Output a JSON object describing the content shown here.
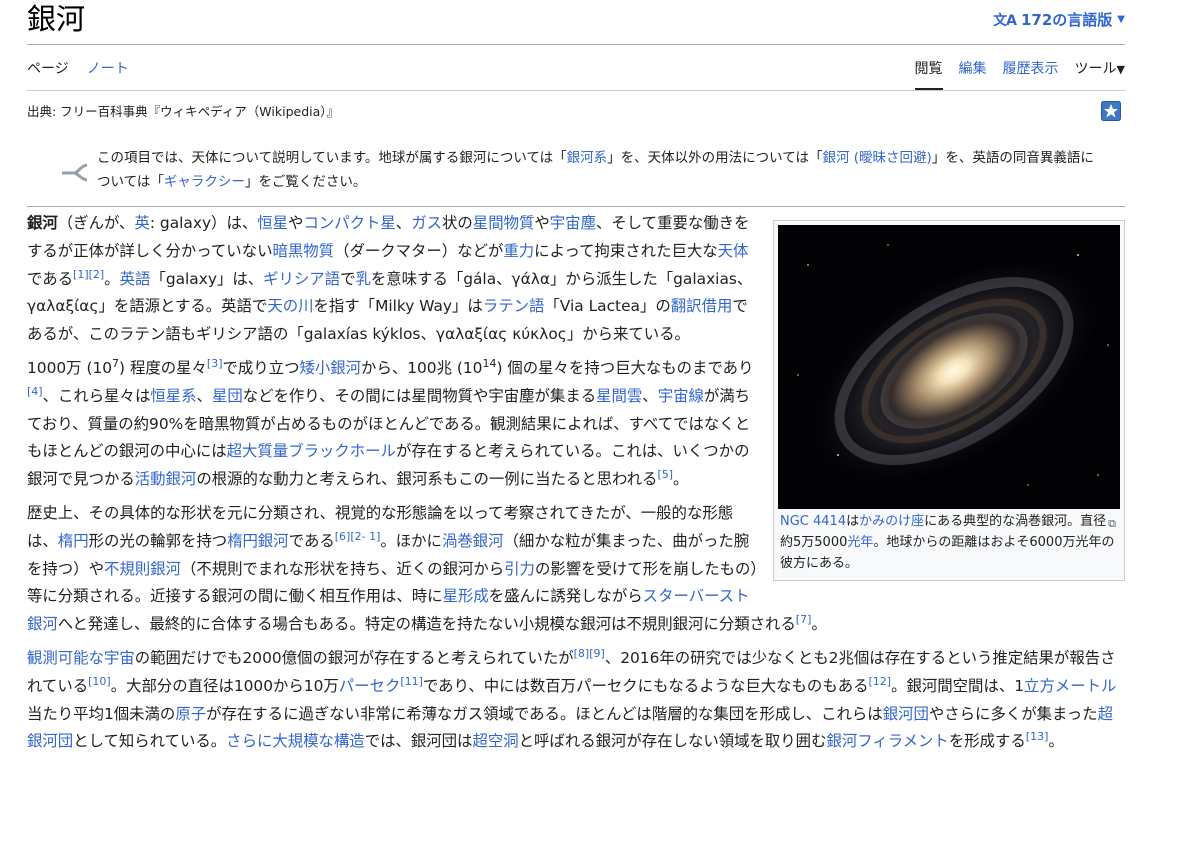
{
  "header": {
    "title": "銀河",
    "languages_label": "172の言語版"
  },
  "tabs": {
    "page": "ページ",
    "talk": "ノート",
    "read": "閲覧",
    "edit": "編集",
    "history": "履歴表示",
    "tools": "ツール"
  },
  "source": "出典: フリー百科事典『ウィキペディア（Wikipedia）』",
  "hatnote": {
    "t1": "この項目では、天体について説明しています。地球が属する銀河については「",
    "l1": "銀河系",
    "t2": "」を、天体以外の用法については「",
    "l2": "銀河 (曖昧さ回避)",
    "t3": "」を、英語の同音異義語については「",
    "l3": "ギャラクシー",
    "t4": "」をご覧ください。"
  },
  "image": {
    "caption": {
      "l1": "NGC 4414",
      "t1": "は",
      "l2": "かみのけ座",
      "t2": "にある典型的な渦巻銀河。直径約5万5000",
      "l3": "光年",
      "t3": "。地球からの距離はおよそ6000万光年の彼方にある。"
    }
  },
  "p1": {
    "b": "銀河",
    "t1": "（ぎんが、",
    "l1": "英",
    "t2": ": galaxy）は、",
    "l2": "恒星",
    "t3": "や",
    "l3": "コンパクト星",
    "t4": "、",
    "l4": "ガス",
    "t5": "状の",
    "l5": "星間物質",
    "t6": "や",
    "l6": "宇宙塵",
    "t7": "、そして重要な働きをするが正体が詳しく分かっていない",
    "l7": "暗黒物質",
    "t8": "（ダークマター）などが",
    "l8": "重力",
    "t9": "によって拘束された巨大な",
    "l9": "天体",
    "t10": "である",
    "s1": "[1]",
    "s2": "[2]",
    "t11": "。",
    "l10": "英語",
    "t12": "「galaxy」は、",
    "l11": "ギリシア語",
    "t13": "で",
    "l12": "乳",
    "t14": "を意味する「gála、γάλα」から派生した「galaxias、γαλαξίας」を語源とする。英語で",
    "l13": "天の川",
    "t15": "を指す「Milky Way」は",
    "l14": "ラテン語",
    "t16": "「Via Lactea」の",
    "l15": "翻訳借用",
    "t17": "であるが、このラテン語もギリシア語の「galaxías kýklos、γαλαξίας κύκλος」から来ている。"
  },
  "p2": {
    "t1": "1000万 (10",
    "e1": "7",
    "t2": ") 程度の星々",
    "s1": "[3]",
    "t3": "で成り立つ",
    "l1": "矮小銀河",
    "t4": "から、100兆 (10",
    "e2": "14",
    "t5": ") 個の星々を持つ巨大なものまであり",
    "s2": "[4]",
    "t6": "、これら星々は",
    "l2": "恒星系",
    "t7": "、",
    "l3": "星団",
    "t8": "などを作り、その間には星間物質や宇宙塵が集まる",
    "l4": "星間雲",
    "t9": "、",
    "l5": "宇宙線",
    "t10": "が満ちており、質量の約90%を暗黒物質が占めるものがほとんどである。観測結果によれば、すべてではなくともほとんどの銀河の中心には",
    "l6": "超大質量ブラックホール",
    "t11": "が存在すると考えられている。これは、いくつかの銀河で見つかる",
    "l7": "活動銀河",
    "t12": "の根源的な動力と考えられ、銀河系もこの一例に当たると思われる",
    "s3": "[5]",
    "t13": "。"
  },
  "p3": {
    "t1": "歴史上、その具体的な形状を元に分類され、視覚的な形態論を以って考察されてきたが、一般的な形態は、",
    "l1": "楕円",
    "t2": "形の光の輪郭を持つ",
    "l2": "楕円銀河",
    "t3": "である",
    "s1": "[6]",
    "s2": "[2- 1]",
    "t4": "。ほかに",
    "l3": "渦巻銀河",
    "t5": "（細かな粒が集まった、曲がった腕を持つ）や",
    "l4": "不規則銀河",
    "t6": "（不規則でまれな形状を持ち、近くの銀河から",
    "l5": "引力",
    "t7": "の影響を受けて形を崩したもの）等に分類される。近接する銀河の間に働く相互作用は、時に",
    "l6": "星形成",
    "t8": "を盛んに誘発しながら",
    "l7": "スターバースト銀河",
    "t9": "へと発達し、最終的に合体する場合もある。特定の構造を持たない小規模な銀河は不規則銀河に分類される",
    "s3": "[7]",
    "t10": "。"
  },
  "p4": {
    "l1": "観測可能な宇宙",
    "t1": "の範囲だけでも2000億個の銀河が存在すると考えられていたが",
    "s1": "[8]",
    "s2": "[9]",
    "t2": "、2016年の研究では少なくとも2兆個は存在するという推定結果が報告されている",
    "s3": "[10]",
    "t3": "。大部分の直径は1000から10万",
    "l2": "パーセク",
    "s4": "[11]",
    "t4": "であり、中には数百万パーセクにもなるような巨大なものもある",
    "s5": "[12]",
    "t5": "。銀河間空間は、1",
    "l3": "立方メートル",
    "t6": "当たり平均1個未満の",
    "l4": "原子",
    "t7": "が存在するに過ぎない非常に希薄なガス領域である。ほとんどは階層的な集団を形成し、これらは",
    "l5": "銀河団",
    "t8": "やさらに多くが集まった",
    "l6": "超銀河団",
    "t9": "として知られている。",
    "l7": "さらに大規模な構造",
    "t10": "では、銀河団は",
    "l8": "超空洞",
    "t11": "と呼ばれる銀河が存在しない領域を取り囲む",
    "l9": "銀河フィラメント",
    "t12": "を形成する",
    "s6": "[13]",
    "t13": "。"
  },
  "colors": {
    "link": "#3366cc",
    "text": "#202122",
    "border": "#a2a9b1"
  },
  "icons": {
    "lang": "translate-icon",
    "star": "featured-star-icon",
    "hatnote": "disambiguation-icon",
    "enlarge": "enlarge-icon"
  }
}
